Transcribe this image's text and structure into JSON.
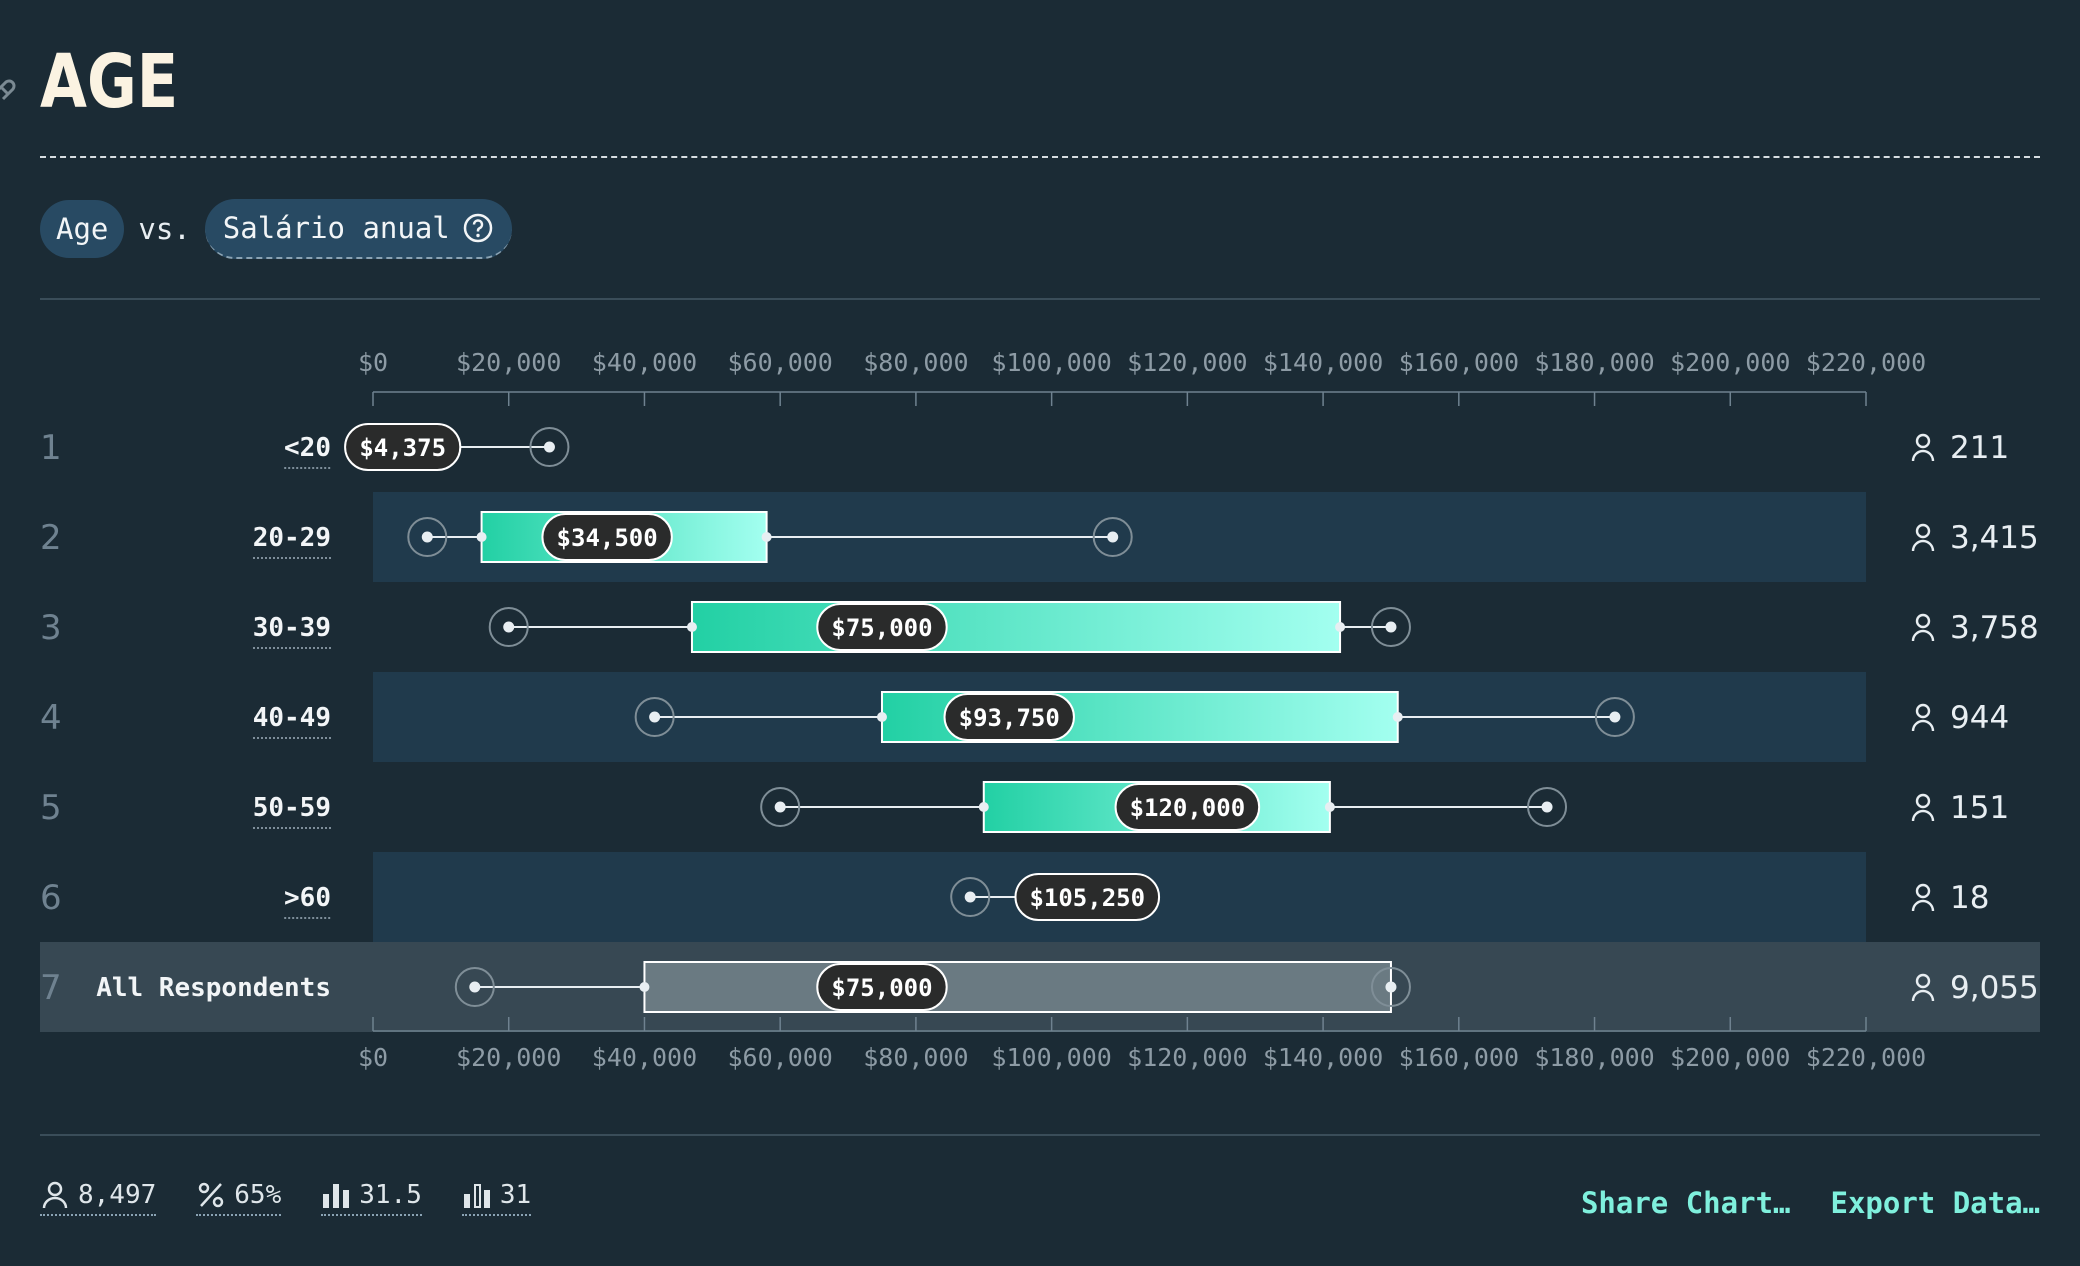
{
  "page": {
    "title": "AGE",
    "filter_dimension": "Age",
    "filter_vs": "vs.",
    "filter_metric": "Salário anual"
  },
  "chart_data": {
    "type": "boxplot",
    "x_ticks": [
      "$0",
      "$20,000",
      "$40,000",
      "$60,000",
      "$80,000",
      "$100,000",
      "$120,000",
      "$140,000",
      "$160,000",
      "$180,000",
      "$200,000",
      "$220,000"
    ],
    "xlim": [
      0,
      220000
    ],
    "rows": [
      {
        "rank": "1",
        "label": "<20",
        "min": 4375,
        "q1": 4375,
        "median": 4375,
        "q3": 4375,
        "max": 26000,
        "median_label": "$4,375",
        "count": "211"
      },
      {
        "rank": "2",
        "label": "20-29",
        "min": 8000,
        "q1": 16000,
        "median": 34500,
        "q3": 58000,
        "max": 109000,
        "median_label": "$34,500",
        "count": "3,415"
      },
      {
        "rank": "3",
        "label": "30-39",
        "min": 20000,
        "q1": 47000,
        "median": 75000,
        "q3": 142500,
        "max": 150000,
        "median_label": "$75,000",
        "count": "3,758"
      },
      {
        "rank": "4",
        "label": "40-49",
        "min": 41500,
        "q1": 75000,
        "median": 93750,
        "q3": 151000,
        "max": 183000,
        "median_label": "$93,750",
        "count": "944"
      },
      {
        "rank": "5",
        "label": "50-59",
        "min": 60000,
        "q1": 90000,
        "median": 120000,
        "q3": 141000,
        "max": 173000,
        "median_label": "$120,000",
        "count": "151"
      },
      {
        "rank": "6",
        "label": ">60",
        "min": 88000,
        "q1": 105250,
        "median": 105250,
        "q3": 105250,
        "max": 105250,
        "median_label": "$105,250",
        "count": "18"
      },
      {
        "rank": "7",
        "label": "All Respondents",
        "min": 15000,
        "q1": 40000,
        "median": 75000,
        "q3": 150000,
        "max": 150000,
        "median_label": "$75,000",
        "count": "9,055",
        "overall": true
      }
    ]
  },
  "footer": {
    "respondents": "8,497",
    "percent": "65%",
    "mean": "31.5",
    "median": "31"
  },
  "actions": {
    "share": "Share Chart…",
    "export": "Export Data…"
  },
  "colors": {
    "background": "#1b2b35",
    "band": "#203a4c",
    "overall_band": "#374853",
    "box_start": "#22d0a4",
    "box_end": "#a3fff0",
    "link": "#7ff0dd"
  }
}
